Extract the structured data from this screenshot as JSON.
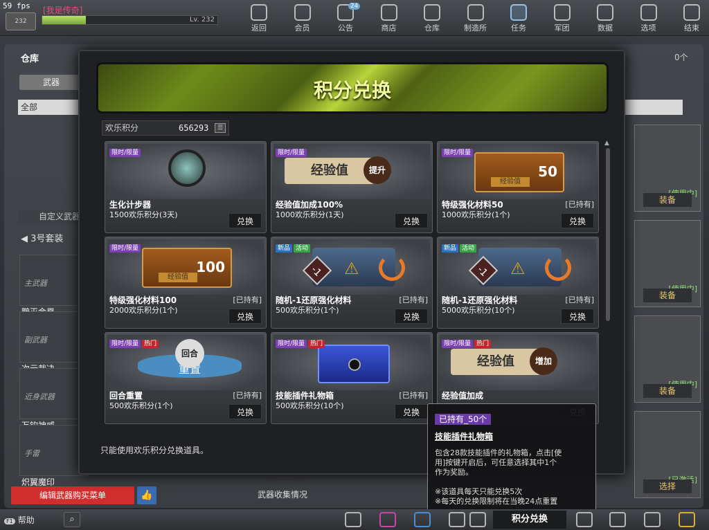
{
  "hud": {
    "fps": "59 fps",
    "avatar_level": "232",
    "nickname": "[我是传奇]",
    "level": "Lv. 232",
    "level_progress": 0.25
  },
  "nav": [
    {
      "label": "返回",
      "icon": "home-icon"
    },
    {
      "label": "会员",
      "icon": "crown-icon"
    },
    {
      "label": "公告",
      "icon": "speaker-icon",
      "badge": "24"
    },
    {
      "label": "商店",
      "icon": "shop-icon"
    },
    {
      "label": "仓库",
      "icon": "warehouse-icon"
    },
    {
      "label": "制造所",
      "icon": "craft-icon"
    },
    {
      "label": "任务",
      "icon": "task-icon"
    },
    {
      "label": "军团",
      "icon": "clan-icon"
    },
    {
      "label": "数据",
      "icon": "info-icon"
    },
    {
      "label": "选项",
      "icon": "gear-icon"
    },
    {
      "label": "结束",
      "icon": "power-icon"
    }
  ],
  "warehouse": {
    "title": "仓库",
    "tab": "武器",
    "filter": "全部",
    "count": "0个",
    "suit_title": "自定义武器套",
    "suit_name": "3号套装",
    "weapons": [
      {
        "category": "主武器",
        "name": "黯灭金凰"
      },
      {
        "category": "副武器",
        "name": "次元裁决"
      },
      {
        "category": "近身武器",
        "name": "万钧神威"
      },
      {
        "category": "手雷",
        "name": "炽翼魔印"
      }
    ],
    "edit_button": "编辑武器购买菜单",
    "collect_label": "武器收集情况",
    "right_items": [
      {
        "status": "[使用中]",
        "button": "装备"
      },
      {
        "status": "[使用中]",
        "button": "装备"
      },
      {
        "status": "[使用中]",
        "button": "装备"
      },
      {
        "status": "[已激活]",
        "button": "选择"
      }
    ]
  },
  "modal": {
    "title": "积分兑换",
    "points_label": "欢乐积分",
    "points_value": "656293",
    "hint": "只能使用欢乐积分兑换道具。",
    "cards": [
      {
        "tags": [
          {
            "t": "限时/限量",
            "c": "purple"
          }
        ],
        "name": "生化计步器",
        "cost": "1500欢乐积分(3天)",
        "owned": "",
        "btn": "兑换",
        "pic": "watch"
      },
      {
        "tags": [
          {
            "t": "限时/限量",
            "c": "purple"
          }
        ],
        "name": "经验值加成100%",
        "cost": "1000欢乐积分(1天)",
        "owned": "",
        "btn": "兑换",
        "pic": "exp",
        "pic_text": "经验值",
        "pic_badge": "提升"
      },
      {
        "tags": [
          {
            "t": "限时/限量",
            "c": "purple"
          }
        ],
        "name": "特级强化材料50",
        "cost": "1000欢乐积分(1个)",
        "owned": "[已持有]",
        "btn": "兑换",
        "pic": "box",
        "pic_num": "50",
        "pic_text": "经验值"
      },
      {
        "tags": [
          {
            "t": "限时/限量",
            "c": "purple"
          }
        ],
        "name": "特级强化材料100",
        "cost": "2000欢乐积分(1个)",
        "owned": "[已持有]",
        "btn": "兑换",
        "pic": "box",
        "pic_num": "100",
        "pic_text": "经验值"
      },
      {
        "tags": [
          {
            "t": "新品",
            "c": "blue"
          },
          {
            "t": "活动",
            "c": "green"
          }
        ],
        "name": "随机-1还原强化材料",
        "cost": "500欢乐积分(1个)",
        "owned": "[已持有]",
        "btn": "兑换",
        "pic": "chest",
        "pic_num": "-1"
      },
      {
        "tags": [
          {
            "t": "新品",
            "c": "blue"
          },
          {
            "t": "活动",
            "c": "green"
          }
        ],
        "name": "随机-1还原强化材料",
        "cost": "5000欢乐积分(10个)",
        "owned": "[已持有]",
        "btn": "兑换",
        "pic": "chest",
        "pic_num": "-1"
      },
      {
        "tags": [
          {
            "t": "限时/限量",
            "c": "purple"
          },
          {
            "t": "热门",
            "c": "red"
          }
        ],
        "name": "回合重置",
        "cost": "500欢乐积分(1个)",
        "owned": "[已持有]",
        "btn": "兑换",
        "pic": "reset",
        "pic_text": "重置",
        "pic_badge": "回合"
      },
      {
        "tags": [
          {
            "t": "限时/限量",
            "c": "purple"
          },
          {
            "t": "热门",
            "c": "red"
          }
        ],
        "name": "技能插件礼物箱",
        "cost": "500欢乐积分(10个)",
        "owned": "[已持有]",
        "btn": "兑换",
        "pic": "gift"
      },
      {
        "tags": [
          {
            "t": "限时/限量",
            "c": "purple"
          },
          {
            "t": "热门",
            "c": "red"
          }
        ],
        "name": "经验值加成",
        "cost": "",
        "owned": "",
        "btn": "兑换",
        "pic": "exp",
        "pic_text": "经验值",
        "pic_badge": "增加"
      }
    ]
  },
  "tooltip": {
    "owned": "已持有_50个",
    "title": "技能插件礼物箱",
    "lines": [
      "包含28款技能插件的礼物箱，点击[使",
      "用]按键开启后，可任意选择其中1个",
      "作为奖励。",
      "",
      "※该道具每天只能兑换5次",
      "※每天的兑换限制将在当晚24点重置"
    ]
  },
  "bottom": {
    "help": "帮助",
    "help_key": "F1",
    "exchange": "积分兑换"
  }
}
